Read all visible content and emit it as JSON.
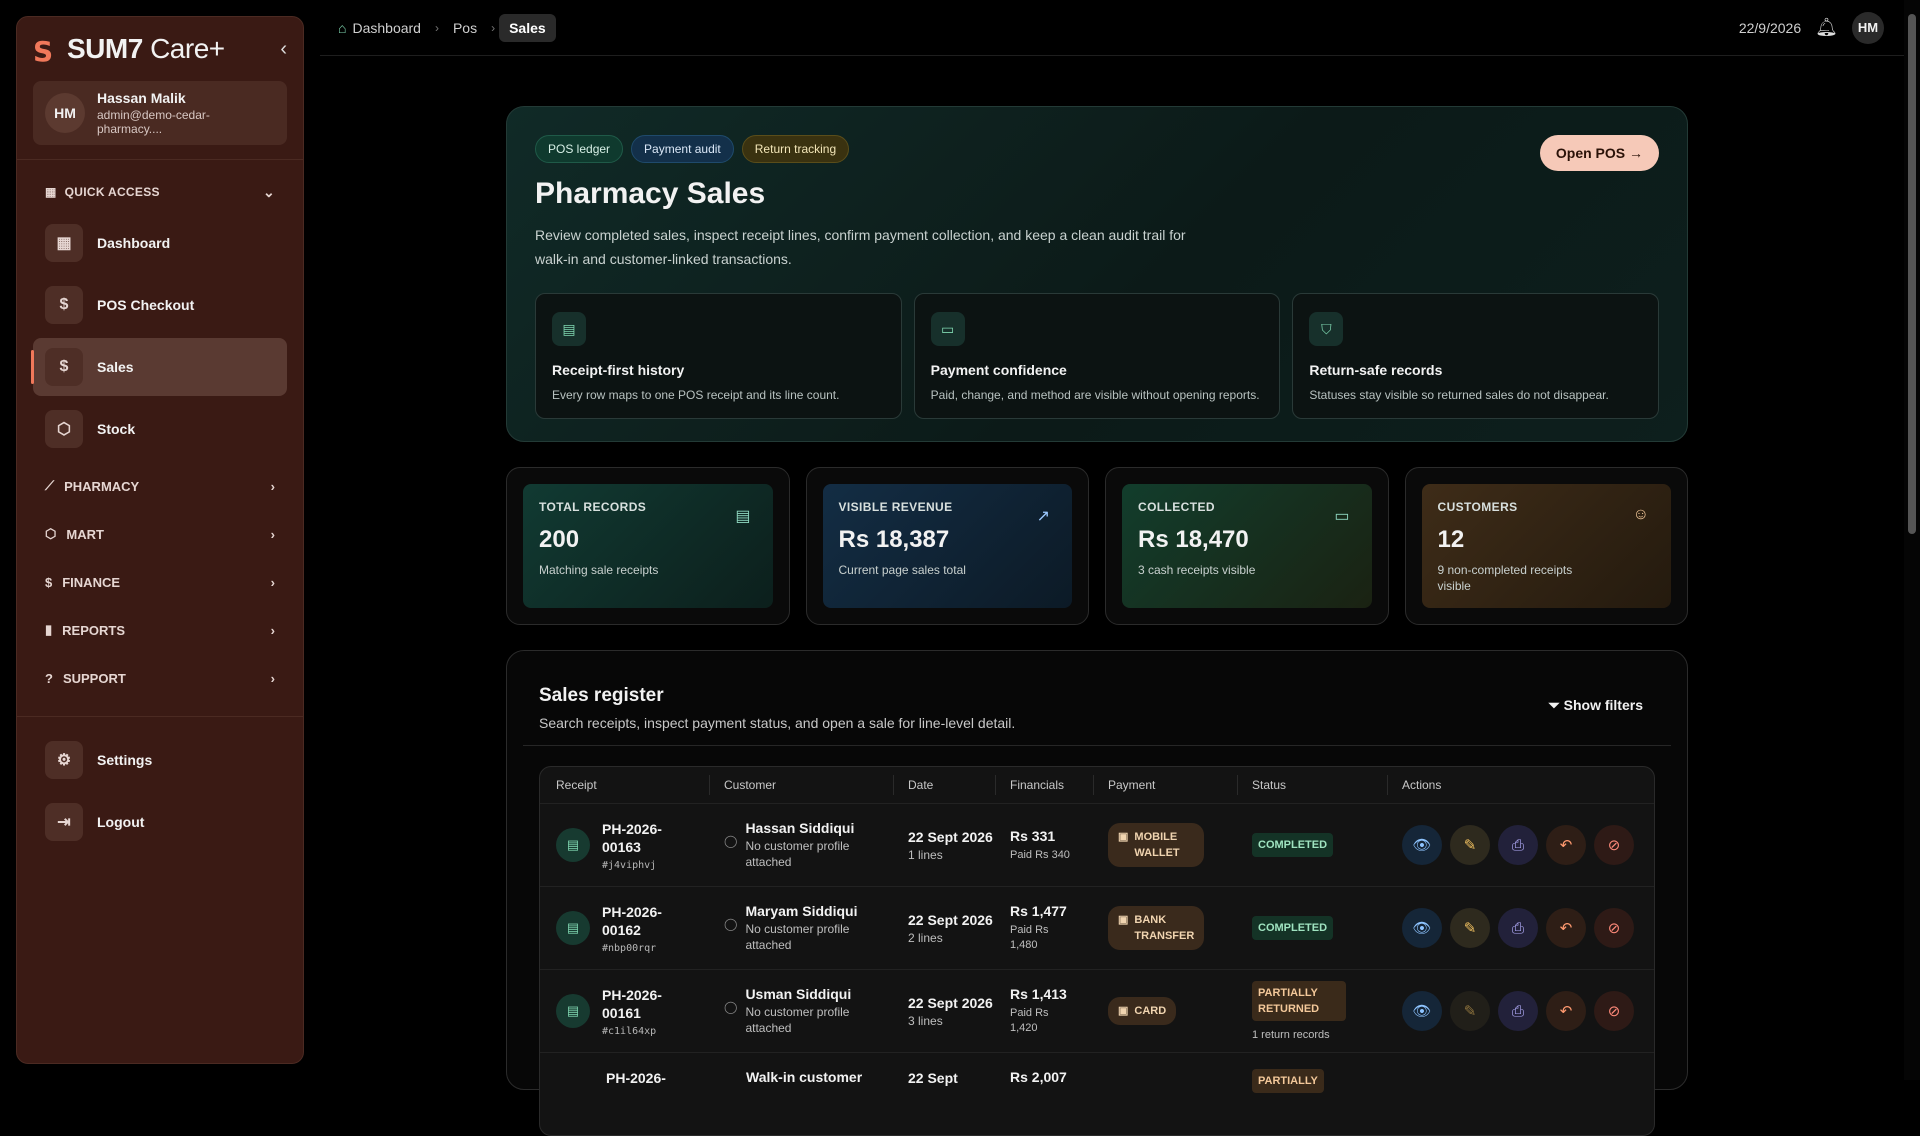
{
  "brand": {
    "name": "SUM7",
    "suffix": "Care+"
  },
  "user": {
    "initials": "HM",
    "name": "Hassan Malik",
    "email": "admin@demo-cedar-pharmacy...."
  },
  "sidebar": {
    "quick_access": "QUICK ACCESS",
    "items": [
      {
        "label": "Dashboard"
      },
      {
        "label": "POS Checkout"
      },
      {
        "label": "Sales"
      },
      {
        "label": "Stock"
      }
    ],
    "groups": [
      {
        "label": "PHARMACY"
      },
      {
        "label": "MART"
      },
      {
        "label": "FINANCE"
      },
      {
        "label": "REPORTS"
      },
      {
        "label": "SUPPORT"
      }
    ],
    "bottom": [
      {
        "label": "Settings"
      },
      {
        "label": "Logout"
      }
    ]
  },
  "breadcrumb": [
    "Dashboard",
    "Pos",
    "Sales"
  ],
  "topbar": {
    "date": "22/9/2026",
    "initials": "HM"
  },
  "hero": {
    "tags": [
      "POS ledger",
      "Payment audit",
      "Return tracking"
    ],
    "title": "Pharmacy Sales",
    "description": "Review completed sales, inspect receipt lines, confirm payment collection, and keep a clean audit trail for walk-in and customer-linked transactions.",
    "open_pos": "Open POS",
    "features": [
      {
        "title": "Receipt-first history",
        "desc": "Every row maps to one POS receipt and its line count."
      },
      {
        "title": "Payment confidence",
        "desc": "Paid, change, and method are visible without opening reports."
      },
      {
        "title": "Return-safe records",
        "desc": "Statuses stay visible so returned sales do not disappear."
      }
    ]
  },
  "stats": [
    {
      "label": "TOTAL RECORDS",
      "value": "200",
      "sub": "Matching sale receipts"
    },
    {
      "label": "VISIBLE REVENUE",
      "value": "Rs 18,387",
      "sub": "Current page sales total"
    },
    {
      "label": "COLLECTED",
      "value": "Rs 18,470",
      "sub": "3 cash receipts visible"
    },
    {
      "label": "CUSTOMERS",
      "value": "12",
      "sub": "9 non-completed receipts visible"
    }
  ],
  "register": {
    "title": "Sales register",
    "subtitle": "Search receipts, inspect payment status, and open a sale for line-level detail.",
    "show_filters": "Show filters",
    "columns": [
      "Receipt",
      "Customer",
      "Date",
      "Financials",
      "Payment",
      "Status",
      "Actions"
    ],
    "rows": [
      {
        "receipt": "PH-2026-00163",
        "code": "#j4viphvj",
        "customer": "Hassan Siddiqui",
        "customer_sub": "No customer profile attached",
        "date": "22 Sept 2026",
        "lines": "1 lines",
        "amount": "Rs 331",
        "paid": "Paid Rs 340",
        "payment": "MOBILE WALLET",
        "status": "COMPLETED",
        "status_note": ""
      },
      {
        "receipt": "PH-2026-00162",
        "code": "#nbp00rqr",
        "customer": "Maryam Siddiqui",
        "customer_sub": "No customer profile attached",
        "date": "22 Sept 2026",
        "lines": "2 lines",
        "amount": "Rs 1,477",
        "paid": "Paid Rs 1,480",
        "payment": "BANK TRANSFER",
        "status": "COMPLETED",
        "status_note": ""
      },
      {
        "receipt": "PH-2026-00161",
        "code": "#c1il64xp",
        "customer": "Usman Siddiqui",
        "customer_sub": "No customer profile attached",
        "date": "22 Sept 2026",
        "lines": "3 lines",
        "amount": "Rs 1,413",
        "paid": "Paid Rs 1,420",
        "payment": "CARD",
        "status": "PARTIALLY RETURNED",
        "status_note": "1 return records"
      },
      {
        "receipt": "PH-2026-",
        "code": "",
        "customer": "Walk-in customer",
        "customer_sub": "",
        "date": "22 Sept",
        "lines": "",
        "amount": "Rs 2,007",
        "paid": "",
        "payment": "",
        "status": "PARTIALLY",
        "status_note": ""
      }
    ]
  },
  "colors": {
    "accent": "#f0785a",
    "sidebar_bg": "#3a1a14",
    "hero_bg": "#102a27"
  }
}
